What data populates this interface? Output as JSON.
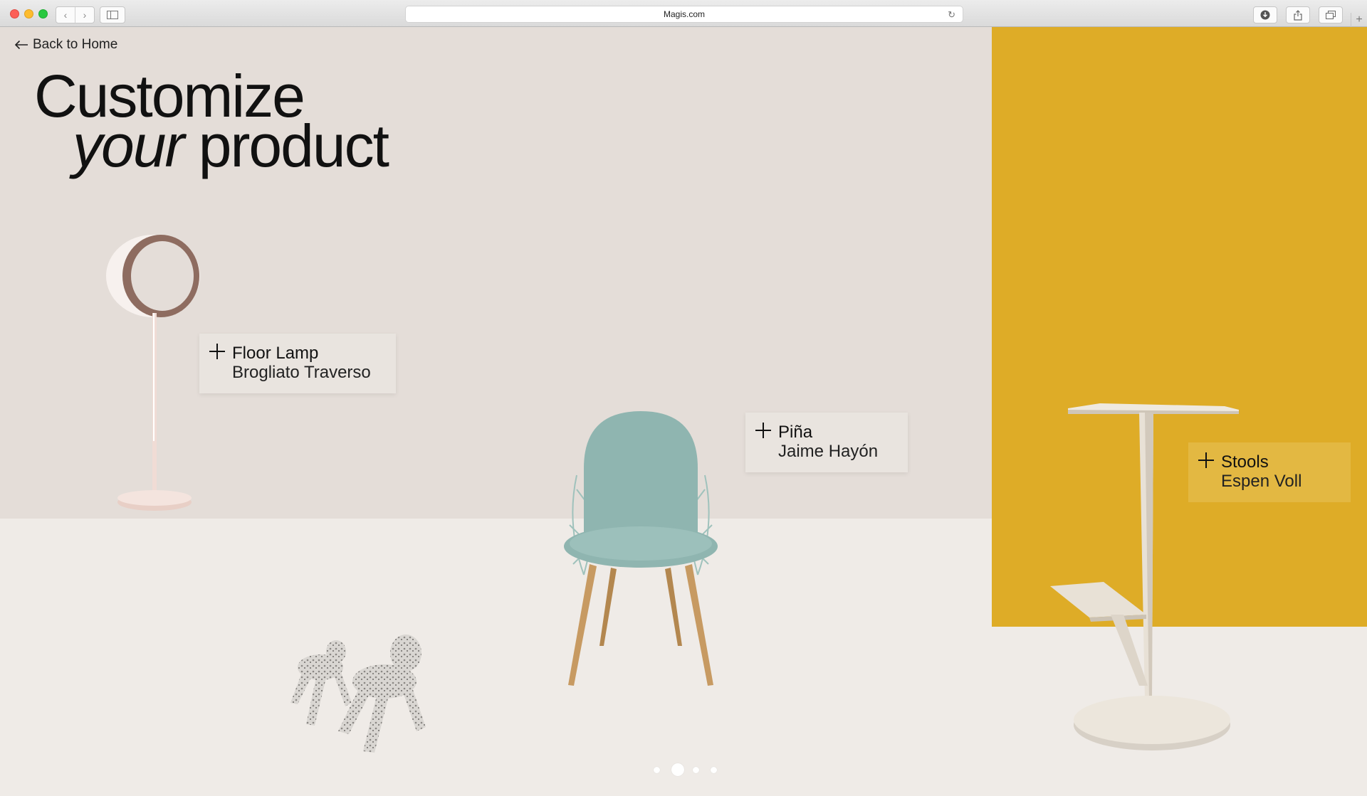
{
  "browser": {
    "url": "Magis.com",
    "icons": [
      "back-arrow-icon",
      "forward-arrow-icon",
      "sidebar-icon",
      "reload-icon",
      "download-icon",
      "share-icon",
      "tabs-icon",
      "new-tab-icon"
    ]
  },
  "page": {
    "back_label": "Back to Home",
    "headline_line1": "Customize",
    "headline_line2_italic": "your",
    "headline_line2_rest": " product",
    "colors": {
      "wall": "#e4ddd8",
      "floor": "#efebe7",
      "accent_yellow": "#deac27"
    }
  },
  "products": [
    {
      "name": "Floor Lamp",
      "designer": "Brogliato Traverso"
    },
    {
      "name": "Piña",
      "designer": "Jaime Hayón"
    },
    {
      "name": "Stools",
      "designer": "Espen Voll"
    }
  ],
  "carousel": {
    "total": 4,
    "active": 2
  }
}
